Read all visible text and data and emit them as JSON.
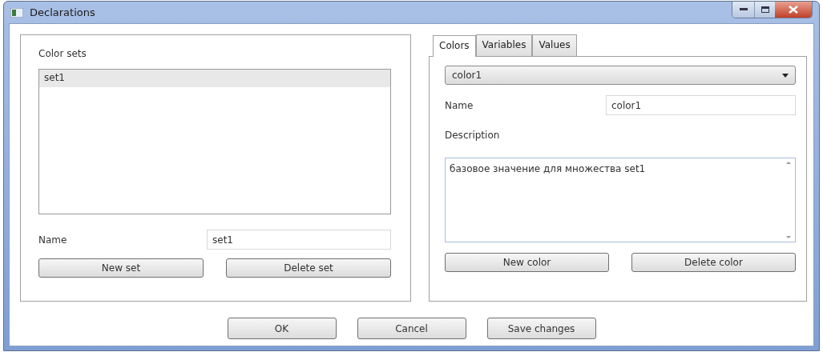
{
  "window": {
    "title": "Declarations"
  },
  "color_sets": {
    "title": "Color sets",
    "items": [
      {
        "label": "set1",
        "selected": true
      }
    ],
    "name_label": "Name",
    "name_value": "set1",
    "buttons": [
      "New set",
      "Delete set"
    ]
  },
  "tabs": [
    {
      "label": "Colors",
      "selected": true
    },
    {
      "label": "Variables",
      "selected": false
    },
    {
      "label": "Values",
      "selected": false
    }
  ],
  "colors": {
    "dropdown_value": "color1",
    "name_label": "Name",
    "name_value": "color1",
    "description_label": "Description",
    "description_value": "базовое значение для множества set1",
    "buttons": [
      "New color",
      "Delete color"
    ]
  },
  "footer_buttons": [
    "OK",
    "Cancel",
    "Save changes"
  ]
}
